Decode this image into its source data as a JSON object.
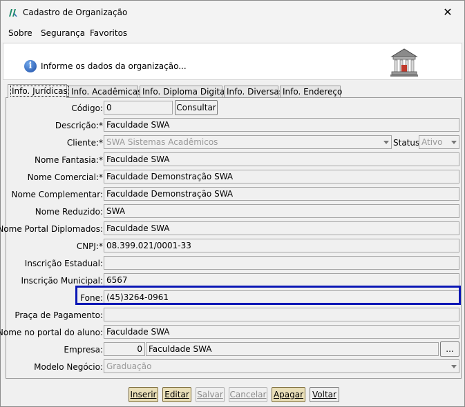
{
  "window": {
    "title": "Cadastro de Organização",
    "close": "✕"
  },
  "menu": {
    "items": [
      {
        "label": "Sobre"
      },
      {
        "label": "Segurança"
      },
      {
        "label": "Favoritos"
      }
    ]
  },
  "header": {
    "info_text": "Informe os dados da organização..."
  },
  "tabs": [
    {
      "label": "Info. Jurídicas"
    },
    {
      "label": "Info. Acadêmicas"
    },
    {
      "label": "Info. Diploma Digital"
    },
    {
      "label": "Info. Diversas"
    },
    {
      "label": "Info. Endereço"
    }
  ],
  "form": {
    "codigo": {
      "label": "Código:",
      "value": "0"
    },
    "consultar_label": "Consultar",
    "descricao": {
      "label": "Descrição:*",
      "value": "Faculdade SWA"
    },
    "cliente": {
      "label": "Cliente:*",
      "value": "SWA Sistemas Acadêmicos"
    },
    "status": {
      "label": "Status:",
      "value": "Ativo"
    },
    "nome_fantasia": {
      "label": "Nome Fantasia:*",
      "value": "Faculdade SWA"
    },
    "nome_comercial": {
      "label": "Nome Comercial:*",
      "value": "Faculdade Demonstração SWA"
    },
    "nome_complementar": {
      "label": "Nome Complementar:",
      "value": "Faculdade Demonstração SWA"
    },
    "nome_reduzido": {
      "label": "Nome Reduzido:",
      "value": "SWA"
    },
    "nome_portal_diplomados": {
      "label": "Nome Portal Diplomados:",
      "value": "Faculdade SWA"
    },
    "cnpj": {
      "label": "CNPJ:*",
      "value": "08.399.021/0001-33"
    },
    "inscricao_estadual": {
      "label": "Inscrição Estadual:",
      "value": ""
    },
    "inscricao_municipal": {
      "label": "Inscrição Municipal:",
      "value": "6567"
    },
    "fone": {
      "label": "Fone:",
      "value": "(45)3264-0961"
    },
    "praca_pagamento": {
      "label": "Praça de Pagamento:",
      "value": ""
    },
    "nome_portal_aluno": {
      "label": "Nome no portal do aluno:",
      "value": "Faculdade SWA"
    },
    "empresa": {
      "label": "Empresa:",
      "code": "0",
      "name": "Faculdade SWA",
      "browse": "..."
    },
    "modelo_negocio": {
      "label": "Modelo Negócio:",
      "value": "Graduação"
    }
  },
  "buttons": {
    "inserir": "Inserir",
    "editar": "Editar",
    "salvar": "Salvar",
    "cancelar": "Cancelar",
    "apagar": "Apagar",
    "voltar": "Voltar"
  },
  "colors": {
    "highlight": "#0a16b5",
    "action_button": "#e9dfb8"
  }
}
